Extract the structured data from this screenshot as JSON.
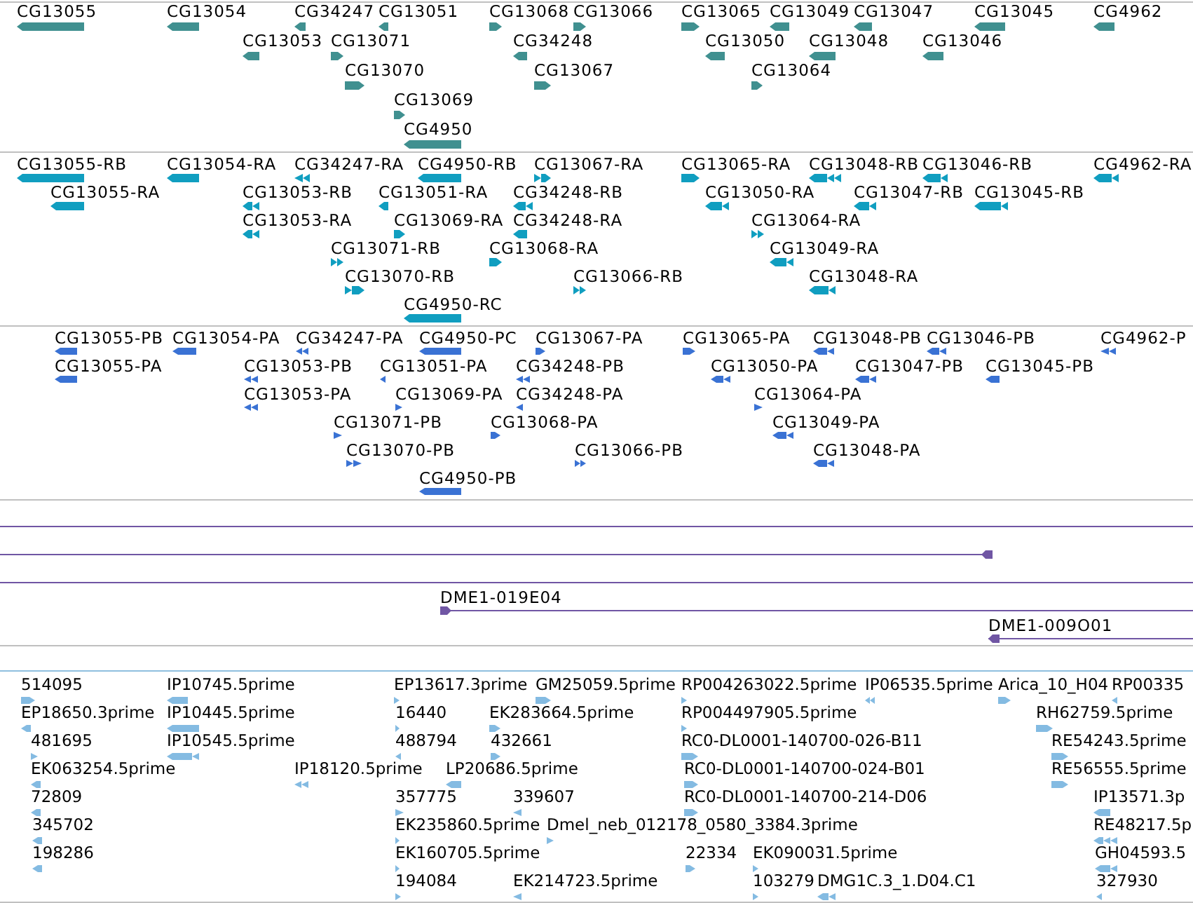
{
  "tracks": [
    {
      "kind": "gene",
      "color": "#409090",
      "features": [
        {
          "label": "CG13055",
          "reverse": true
        },
        {
          "label": "CG13054",
          "reverse": true
        },
        {
          "label": "CG34247",
          "reverse": true
        },
        {
          "label": "CG13051",
          "reverse": true
        },
        {
          "label": "CG13068",
          "reverse": false
        },
        {
          "label": "CG13066",
          "reverse": false
        },
        {
          "label": "CG13065",
          "reverse": false
        },
        {
          "label": "CG13049",
          "reverse": true
        },
        {
          "label": "CG13047",
          "reverse": true
        },
        {
          "label": "CG13045",
          "reverse": true
        },
        {
          "label": "CG4962",
          "reverse": true
        },
        {
          "label": "CG13053",
          "reverse": true
        },
        {
          "label": "CG13071",
          "reverse": false
        },
        {
          "label": "CG34248",
          "reverse": true
        },
        {
          "label": "CG13050",
          "reverse": true
        },
        {
          "label": "CG13048",
          "reverse": true
        },
        {
          "label": "CG13046",
          "reverse": true
        },
        {
          "label": "CG13070",
          "reverse": false
        },
        {
          "label": "CG13067",
          "reverse": false
        },
        {
          "label": "CG13064",
          "reverse": false
        },
        {
          "label": "CG13069",
          "reverse": false
        },
        {
          "label": "CG4950",
          "reverse": true
        }
      ]
    },
    {
      "kind": "transcript",
      "color": "#109ec0",
      "features": [
        {
          "label": "CG13055-RB",
          "reverse": true
        },
        {
          "label": "CG13054-RA",
          "reverse": true
        },
        {
          "label": "CG34247-RA",
          "reverse": true
        },
        {
          "label": "CG4950-RB",
          "reverse": true
        },
        {
          "label": "CG13067-RA",
          "reverse": false
        },
        {
          "label": "CG13065-RA",
          "reverse": false
        },
        {
          "label": "CG13048-RB",
          "reverse": true
        },
        {
          "label": "CG13046-RB",
          "reverse": true
        },
        {
          "label": "CG4962-RA",
          "reverse": true
        },
        {
          "label": "CG13055-RA",
          "reverse": true
        },
        {
          "label": "CG13053-RB",
          "reverse": true
        },
        {
          "label": "CG13051-RA",
          "reverse": true
        },
        {
          "label": "CG34248-RB",
          "reverse": true
        },
        {
          "label": "CG13050-RA",
          "reverse": true
        },
        {
          "label": "CG13047-RB",
          "reverse": true
        },
        {
          "label": "CG13045-RB",
          "reverse": true
        },
        {
          "label": "CG13053-RA",
          "reverse": true
        },
        {
          "label": "CG13069-RA",
          "reverse": false
        },
        {
          "label": "CG34248-RA",
          "reverse": true
        },
        {
          "label": "CG13064-RA",
          "reverse": false
        },
        {
          "label": "CG13071-RB",
          "reverse": false
        },
        {
          "label": "CG13068-RA",
          "reverse": false
        },
        {
          "label": "CG13049-RA",
          "reverse": true
        },
        {
          "label": "CG13070-RB",
          "reverse": false
        },
        {
          "label": "CG13066-RB",
          "reverse": false
        },
        {
          "label": "CG13048-RA",
          "reverse": true
        },
        {
          "label": "CG4950-RC",
          "reverse": true
        }
      ]
    },
    {
      "kind": "protein",
      "color": "#3a72d4",
      "features": [
        {
          "label": "CG13055-PB",
          "reverse": true
        },
        {
          "label": "CG13054-PA",
          "reverse": true
        },
        {
          "label": "CG34247-PA",
          "reverse": true
        },
        {
          "label": "CG4950-PC",
          "reverse": true
        },
        {
          "label": "CG13067-PA",
          "reverse": false
        },
        {
          "label": "CG13065-PA",
          "reverse": false
        },
        {
          "label": "CG13048-PB",
          "reverse": true
        },
        {
          "label": "CG13046-PB",
          "reverse": true
        },
        {
          "label": "CG4962-P",
          "reverse": true
        },
        {
          "label": "CG13055-PA",
          "reverse": true
        },
        {
          "label": "CG13053-PB",
          "reverse": true
        },
        {
          "label": "CG13051-PA",
          "reverse": true
        },
        {
          "label": "CG34248-PB",
          "reverse": true
        },
        {
          "label": "CG13050-PA",
          "reverse": true
        },
        {
          "label": "CG13047-PB",
          "reverse": true
        },
        {
          "label": "CG13045-PB",
          "reverse": true
        },
        {
          "label": "CG13053-PA",
          "reverse": true
        },
        {
          "label": "CG13069-PA",
          "reverse": false
        },
        {
          "label": "CG34248-PA",
          "reverse": true
        },
        {
          "label": "CG13064-PA",
          "reverse": false
        },
        {
          "label": "CG13071-PB",
          "reverse": false
        },
        {
          "label": "CG13068-PA",
          "reverse": false
        },
        {
          "label": "CG13049-PA",
          "reverse": true
        },
        {
          "label": "CG13070-PB",
          "reverse": false
        },
        {
          "label": "CG13066-PB",
          "reverse": false
        },
        {
          "label": "CG13048-PA",
          "reverse": true
        },
        {
          "label": "CG4950-PB",
          "reverse": true
        }
      ]
    },
    {
      "kind": "clone",
      "color": "#7056a4",
      "features": [
        {
          "kind": "span"
        },
        {
          "kind": "end",
          "reverse": true
        },
        {
          "kind": "span"
        },
        {
          "kind": "start",
          "label": "DME1-019E04",
          "reverse": false
        },
        {
          "kind": "start",
          "label": "DME1-009O01",
          "reverse": true
        }
      ]
    },
    {
      "kind": "est",
      "color": "#84bbe2",
      "features": [
        {
          "label": "514095",
          "reverse": false
        },
        {
          "label": "IP10745.5prime",
          "reverse": true
        },
        {
          "label": "EP13617.3prime",
          "reverse": false
        },
        {
          "label": "GM25059.5prime",
          "reverse": false
        },
        {
          "label": "RP004263022.5prime",
          "reverse": false
        },
        {
          "label": "IP06535.5prime",
          "reverse": true
        },
        {
          "label": "Arica_10_H04",
          "reverse": false
        },
        {
          "label": "RP00335",
          "reverse": true
        },
        {
          "label": "EP18650.3prime",
          "reverse": true
        },
        {
          "label": "IP10445.5prime",
          "reverse": true
        },
        {
          "label": "16440",
          "reverse": false
        },
        {
          "label": "EK283664.5prime",
          "reverse": false
        },
        {
          "label": "RP004497905.5prime",
          "reverse": false
        },
        {
          "label": "RH62759.5prime",
          "reverse": false
        },
        {
          "label": "481695",
          "reverse": false
        },
        {
          "label": "IP10545.5prime",
          "reverse": true
        },
        {
          "label": "488794",
          "reverse": true
        },
        {
          "label": "432661",
          "reverse": false
        },
        {
          "label": "RC0-DL0001-140700-026-B11",
          "reverse": false
        },
        {
          "label": "RE54243.5prime",
          "reverse": false
        },
        {
          "label": "EK063254.5prime",
          "reverse": true
        },
        {
          "label": "IP18120.5prime",
          "reverse": true
        },
        {
          "label": "LP20686.5prime",
          "reverse": true
        },
        {
          "label": "RC0-DL0001-140700-024-B01",
          "reverse": false
        },
        {
          "label": "RE56555.5prime",
          "reverse": false
        },
        {
          "label": "72809",
          "reverse": true
        },
        {
          "label": "357775",
          "reverse": false
        },
        {
          "label": "339607",
          "reverse": true
        },
        {
          "label": "RC0-DL0001-140700-214-D06",
          "reverse": false
        },
        {
          "label": "IP13571.3p",
          "reverse": true
        },
        {
          "label": "345702",
          "reverse": true
        },
        {
          "label": "EK235860.5prime",
          "reverse": false
        },
        {
          "label": "Dmel_neb_012178_0580_3384.3prime",
          "reverse": false
        },
        {
          "label": "RE48217.5p",
          "reverse": true
        },
        {
          "label": "198286",
          "reverse": true
        },
        {
          "label": "EK160705.5prime",
          "reverse": false
        },
        {
          "label": "22334",
          "reverse": false
        },
        {
          "label": "EK090031.5prime",
          "reverse": false
        },
        {
          "label": "GH04593.5",
          "reverse": true
        },
        {
          "label": "194084",
          "reverse": false
        },
        {
          "label": "EK214723.5prime",
          "reverse": true
        },
        {
          "label": "103279",
          "reverse": false
        },
        {
          "label": "DMG1C.3_1.D04.C1",
          "reverse": true
        },
        {
          "label": "327930",
          "reverse": true
        }
      ]
    }
  ]
}
